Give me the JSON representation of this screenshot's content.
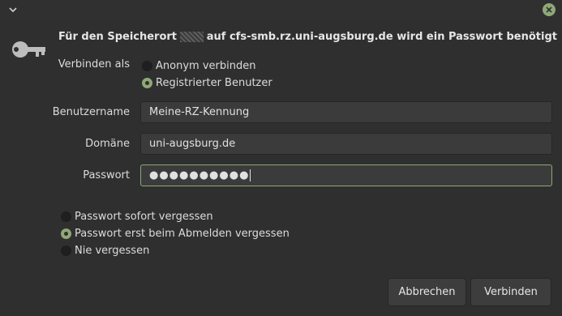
{
  "titlebar": {
    "menu_icon": "chevron-down-icon",
    "close_icon": "close-icon"
  },
  "heading": {
    "prefix": "Für den Speicherort",
    "suffix": "auf cfs-smb.rz.uni-augsburg.de wird ein Passwort benötigt"
  },
  "connect_as": {
    "label": "Verbinden als",
    "options": [
      {
        "label": "Anonym verbinden",
        "checked": false
      },
      {
        "label": "Registrierter Benutzer",
        "checked": true
      }
    ]
  },
  "fields": {
    "username": {
      "label": "Benutzername",
      "value": "Meine-RZ-Kennung"
    },
    "domain": {
      "label": "Domäne",
      "value": "uni-augsburg.de"
    },
    "password": {
      "label": "Passwort",
      "value": "●●●●●●●●●●"
    }
  },
  "remember": {
    "options": [
      {
        "label": "Passwort sofort vergessen",
        "checked": false
      },
      {
        "label": "Passwort erst beim Abmelden vergessen",
        "checked": true
      },
      {
        "label": "Nie vergessen",
        "checked": false
      }
    ]
  },
  "buttons": {
    "cancel": "Abbrechen",
    "connect": "Verbinden"
  },
  "colors": {
    "accent": "#8fa876",
    "background": "#2f2f2f"
  }
}
